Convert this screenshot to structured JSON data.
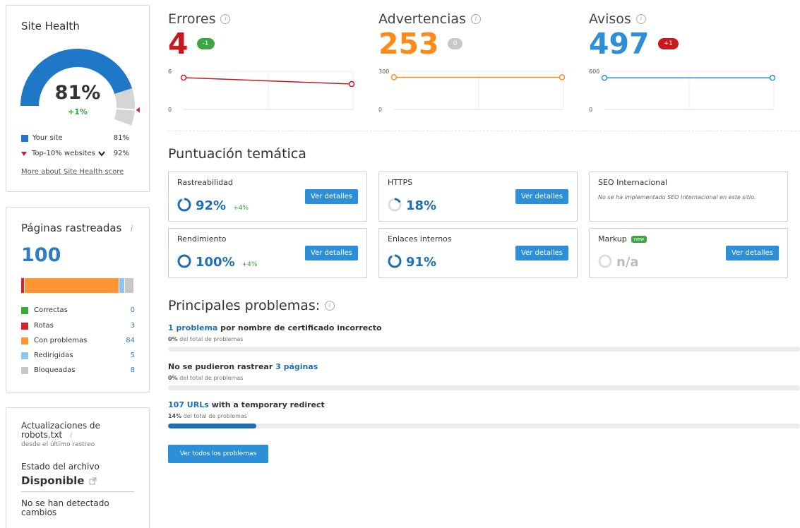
{
  "site_health": {
    "title": "Site Health",
    "score": "81%",
    "score_value": 81,
    "top10_value": 92,
    "delta": "+1%",
    "legend": [
      {
        "label": "Your site",
        "value": "81%",
        "color": "#1f77c8"
      },
      {
        "label": "Top-10% websites",
        "value": "92%",
        "color": "#c7242c"
      }
    ],
    "more_link": "More about Site Health score"
  },
  "crawled": {
    "title": "Páginas rastreadas",
    "total": "100",
    "bar": [
      {
        "key": "rotas",
        "fraction": 0.03,
        "color": "#d6222a"
      },
      {
        "key": "problemas",
        "fraction": 0.84,
        "color": "#ff9533"
      },
      {
        "key": "redirigidas",
        "fraction": 0.05,
        "color": "#8fc4ec"
      },
      {
        "key": "bloqueadas",
        "fraction": 0.08,
        "color": "#c8c8c8"
      }
    ],
    "rows": [
      {
        "label": "Correctas",
        "value": "0",
        "color": "#3aaa35"
      },
      {
        "label": "Rotas",
        "value": "3",
        "color": "#d6222a"
      },
      {
        "label": "Con problemas",
        "value": "84",
        "color": "#ff9533"
      },
      {
        "label": "Redirigidas",
        "value": "5",
        "color": "#8fc4ec"
      },
      {
        "label": "Bloqueadas",
        "value": "8",
        "color": "#c8c8c8"
      }
    ]
  },
  "robots": {
    "title": "Actualizaciones de robots.txt",
    "subtitle": "desde el último rastreo",
    "file_label": "Estado del archivo",
    "file_status": "Disponible",
    "note": "No se han detectado cambios"
  },
  "metrics": [
    {
      "label": "Errores",
      "value": "4",
      "color": "#c8191f",
      "badge": "-1",
      "badge_color": "#3ca643",
      "ymax": "6",
      "ymin": "0",
      "line_color": "#c8191f",
      "points": [
        5,
        4
      ],
      "scale": 6
    },
    {
      "label": "Advertencias",
      "value": "253",
      "color": "#ff8a1a",
      "badge": "0",
      "badge_color": "#c8c8c8",
      "ymax": "300",
      "ymin": "0",
      "line_color": "#ff8a1a",
      "points": [
        253,
        253
      ],
      "scale": 300
    },
    {
      "label": "Avisos",
      "value": "497",
      "color": "#2d8fd8",
      "badge": "+1",
      "badge_color": "#c8191f",
      "ymax": "600",
      "ymin": "0",
      "line_color": "#2d8fd8",
      "points": [
        497,
        497
      ],
      "scale": 600
    }
  ],
  "thematic": {
    "title": "Puntuación temática",
    "button_label": "Ver detalles",
    "cards": [
      {
        "name": "Rastreabilidad",
        "pct": "92%",
        "value": 92,
        "delta": "+4%"
      },
      {
        "name": "HTTPS",
        "pct": "18%",
        "value": 18,
        "delta": ""
      },
      {
        "name": "SEO Internacional",
        "desc": "No se ha implementado SEO Internacional en este sitio."
      },
      {
        "name": "Rendimiento",
        "pct": "100%",
        "value": 100,
        "delta": "+4%"
      },
      {
        "name": "Enlaces internos",
        "pct": "91%",
        "value": 91,
        "delta": ""
      },
      {
        "name": "Markup",
        "badge": "new",
        "pct": "n/a",
        "value": null
      }
    ]
  },
  "issues": {
    "title": "Principales problemas:",
    "items": [
      {
        "link": "1 problema",
        "text": " por nombre de certificado incorrecto",
        "link_first": true,
        "pct": "0%",
        "sub": " del total de problemas",
        "fraction": 0
      },
      {
        "link": "3 páginas",
        "text": "No se pudieron rastrear ",
        "link_first": false,
        "pct": "0%",
        "sub": " del total de problemas",
        "fraction": 0
      },
      {
        "link": "107 URLs",
        "text": " with a temporary redirect",
        "link_first": true,
        "pct": "14%",
        "sub": " del total de problemas",
        "fraction": 0.14
      }
    ],
    "all_button": "Ver todos los problemas"
  }
}
